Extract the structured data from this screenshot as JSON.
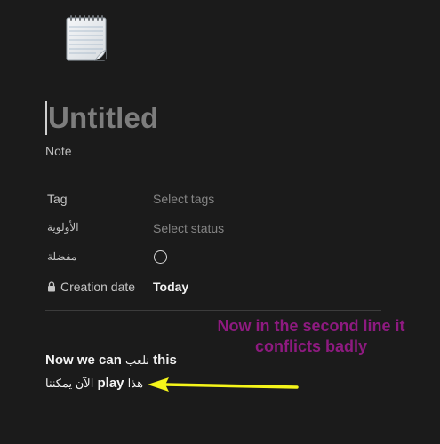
{
  "page": {
    "icon": "notepad-icon",
    "title": "Untitled",
    "subtitle": "Note"
  },
  "properties": [
    {
      "label": "Tag",
      "value": "Select tags",
      "icon": null
    },
    {
      "label": "الأولوية",
      "value": "Select status",
      "icon": null
    },
    {
      "label": "مفضلة",
      "value": "",
      "control": "circle-checkbox"
    },
    {
      "label": "Creation date",
      "value": "Today",
      "icon": "lock-icon"
    }
  ],
  "body": {
    "line1": {
      "part_a": "Now we can",
      "part_b": "نلعب",
      "part_c": "this"
    },
    "line2": {
      "part_a": "الآن يمكننا",
      "part_b": "play",
      "part_c": "هذا"
    }
  },
  "annotation": {
    "text": "Now in the second line it conflicts badly",
    "color": "#8e1a80"
  },
  "arrow": {
    "color": "#f5f51a"
  }
}
